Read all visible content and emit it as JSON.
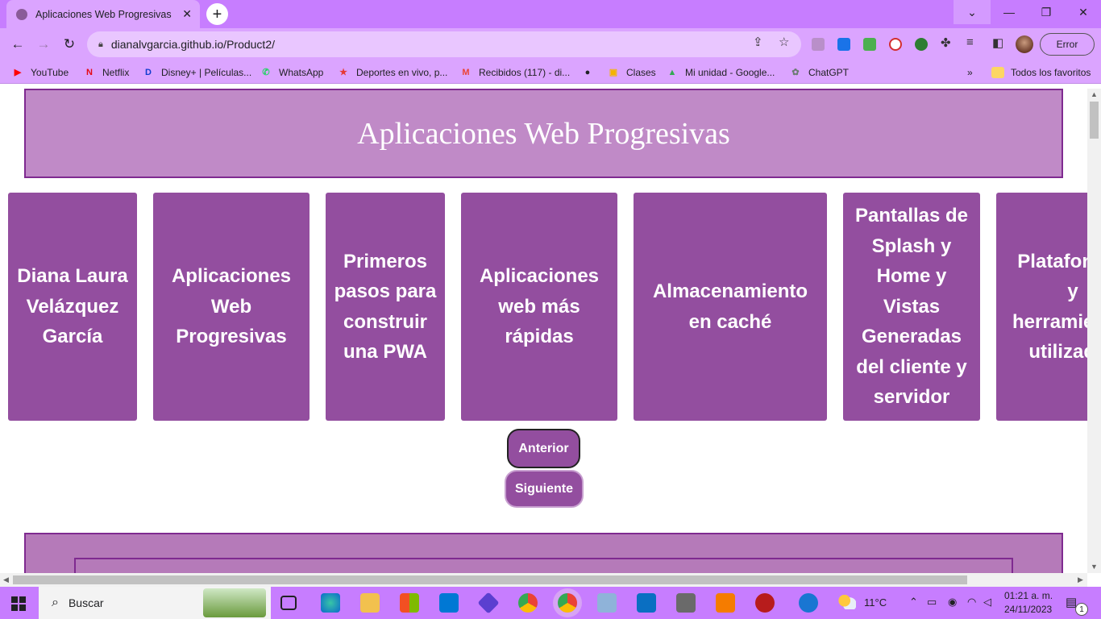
{
  "browser": {
    "tab_title": "Aplicaciones Web Progresivas",
    "url": "dianalvgarcia.github.io/Product2/",
    "error_button": "Error",
    "bookmarks": [
      {
        "label": "YouTube",
        "icon": "youtube-icon",
        "color": "#ff0000"
      },
      {
        "label": "Netflix",
        "icon": "netflix-icon",
        "color": "#e50914"
      },
      {
        "label": "Disney+ | Películas...",
        "icon": "disney-icon",
        "color": "#113ccf"
      },
      {
        "label": "WhatsApp",
        "icon": "whatsapp-icon",
        "color": "#25d366"
      },
      {
        "label": "Deportes en vivo, p...",
        "icon": "star-icon",
        "color": "#e53935"
      },
      {
        "label": "Recibidos (117) - di...",
        "icon": "gmail-icon",
        "color": "#ea4335"
      },
      {
        "label": "",
        "icon": "globe-icon",
        "color": "#202124"
      },
      {
        "label": "Clases",
        "icon": "classroom-icon",
        "color": "#f4b400"
      },
      {
        "label": "Mi unidad - Google...",
        "icon": "drive-icon",
        "color": "#34a853"
      },
      {
        "label": "ChatGPT",
        "icon": "chatgpt-icon",
        "color": "#6b7b72"
      }
    ],
    "all_bookmarks": "Todos los favoritos"
  },
  "page": {
    "title": "Aplicaciones Web Progresivas",
    "cards": [
      "Diana Laura Velázquez García",
      "Aplicaciones Web Progresivas",
      "Primeros pasos para construir una PWA",
      "Aplicaciones web más rápidas",
      "Almacenamiento en caché",
      "Pantallas de Splash y Home y Vistas Generadas del cliente y servidor",
      "Plataformas y herramientas utilizadas"
    ],
    "prev_label": "Anterior",
    "next_label": "Siguiente"
  },
  "taskbar": {
    "search_label": "Buscar",
    "temperature": "11°C",
    "time": "01:21 a. m.",
    "date": "24/11/2023",
    "notifications": "1"
  },
  "colors": {
    "chrome_frame": "#c77dff",
    "card": "#934e9f",
    "header": "#c08ac7",
    "border": "#7f2a90"
  }
}
